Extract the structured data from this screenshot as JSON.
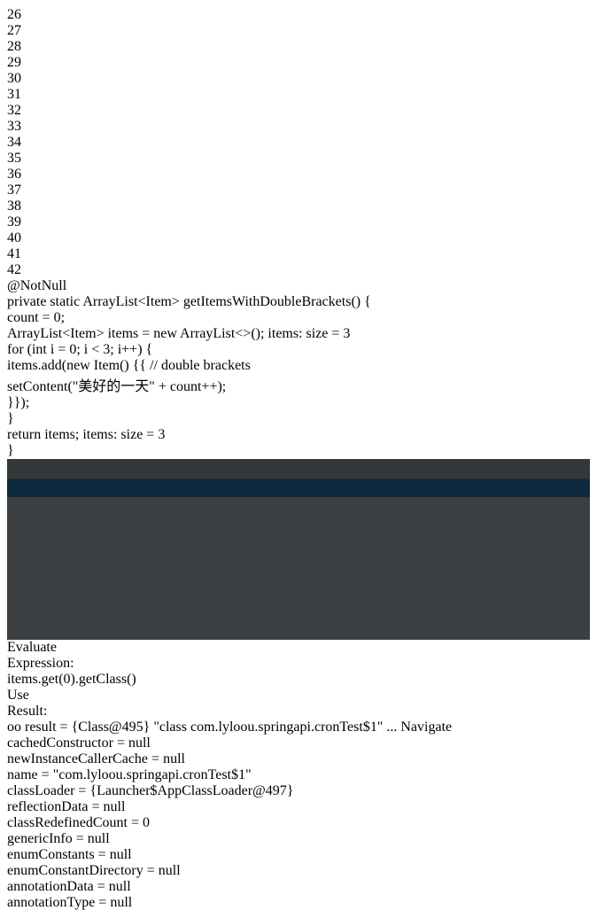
{
  "editor": {
    "gutter_lines": [
      "26",
      "27",
      "28",
      "29",
      "30",
      "31",
      "32",
      "33",
      "34",
      "35",
      "36",
      "37",
      "38",
      "39",
      "40",
      "41",
      "42"
    ],
    "current_line": "35",
    "annotation": "@NotNull",
    "sig_kw": "private static ",
    "sig_type": "ArrayList",
    "sig_lt": "<",
    "sig_generic": "Item",
    "sig_gt": "> ",
    "sig_method": "getItemsWithDoubleBrackets",
    "sig_rest": "() {",
    "l28_field": "count",
    "l28_eq": " = ",
    "l28_num": "0",
    "l28_end": ";",
    "l29_type": "ArrayList",
    "l29_lt": "<",
    "l29_generic": "Item",
    "l29_mid": "> items = ",
    "l29_new": "new",
    "l29_cls": " ArrayList",
    "l29_diamond": "<>",
    "l29_end": "();",
    "l29_hint": "items:  size = 3",
    "l30_for": "for",
    "l30_a": " (",
    "l30_int": "int",
    "l30_b": " i = ",
    "l30_n0": "0",
    "l30_c": "; i < ",
    "l30_n3": "3",
    "l30_d": "; i++) {",
    "l31_a": "items.add(",
    "l31_new": "new",
    "l31_b": " Item() ",
    "l31_brace": "{{",
    "l31_comment": " // double brackets",
    "l32_a": "setContent(",
    "l32_str": "\"美好的一天\"",
    "l32_b": " + ",
    "l32_field": "count",
    "l32_c": "++);",
    "l33_brace": "}}",
    "l33_end": ");",
    "l34": "}",
    "l35_ret": "return",
    "l35_rest": " items;",
    "l35_hint": "items:  size = 3",
    "l36": "}"
  },
  "dialog": {
    "title": "Evaluate",
    "expression_label": "Expression:",
    "expression_pre": "items.get(",
    "expression_num": "0",
    "expression_mid": ").getClass",
    "expression_open": "(",
    "expression_close": ")",
    "use_hint": "Use",
    "result_label": "Result:",
    "root": {
      "watch_icon": "oo",
      "name": "result",
      "eq": " = ",
      "type": "{Class@495}",
      "value": " \"class com.lyloou.springapi.cronTest$1\"",
      "link": " ... Navigate"
    },
    "fields": [
      {
        "name": "cachedConstructor",
        "eq": " = ",
        "value": "null",
        "kind": "plain",
        "expand": false
      },
      {
        "name": "newInstanceCallerCache",
        "eq": " = ",
        "value": "null",
        "kind": "plain",
        "expand": false
      },
      {
        "name": "name",
        "eq": " = ",
        "value": "\"com.lyloou.springapi.cronTest$1\"",
        "kind": "string",
        "expand": true
      },
      {
        "name": "classLoader",
        "eq": " = ",
        "value": "{Launcher$AppClassLoader@497}",
        "kind": "object",
        "expand": true
      },
      {
        "name": "reflectionData",
        "eq": " = ",
        "value": "null",
        "kind": "plain",
        "expand": false
      },
      {
        "name": "classRedefinedCount",
        "eq": " = ",
        "value": "0",
        "kind": "plain",
        "expand": false
      },
      {
        "name": "genericInfo",
        "eq": " = ",
        "value": "null",
        "kind": "plain",
        "expand": false
      },
      {
        "name": "enumConstants",
        "eq": " = ",
        "value": "null",
        "kind": "plain",
        "expand": false
      },
      {
        "name": "enumConstantDirectory",
        "eq": " = ",
        "value": "null",
        "kind": "plain",
        "expand": false
      },
      {
        "name": "annotationData",
        "eq": " = ",
        "value": "null",
        "kind": "plain",
        "expand": false
      },
      {
        "name": "annotationType",
        "eq": " = ",
        "value": "null",
        "kind": "plain",
        "expand": false
      }
    ]
  },
  "colors": {
    "editor_bg": "#2b2b2b",
    "current_line_bg": "#2d6099",
    "dialog_bg": "#3c3f41",
    "field_name": "#e8626e",
    "link": "#589df6",
    "breakpoint": "#c75450"
  }
}
